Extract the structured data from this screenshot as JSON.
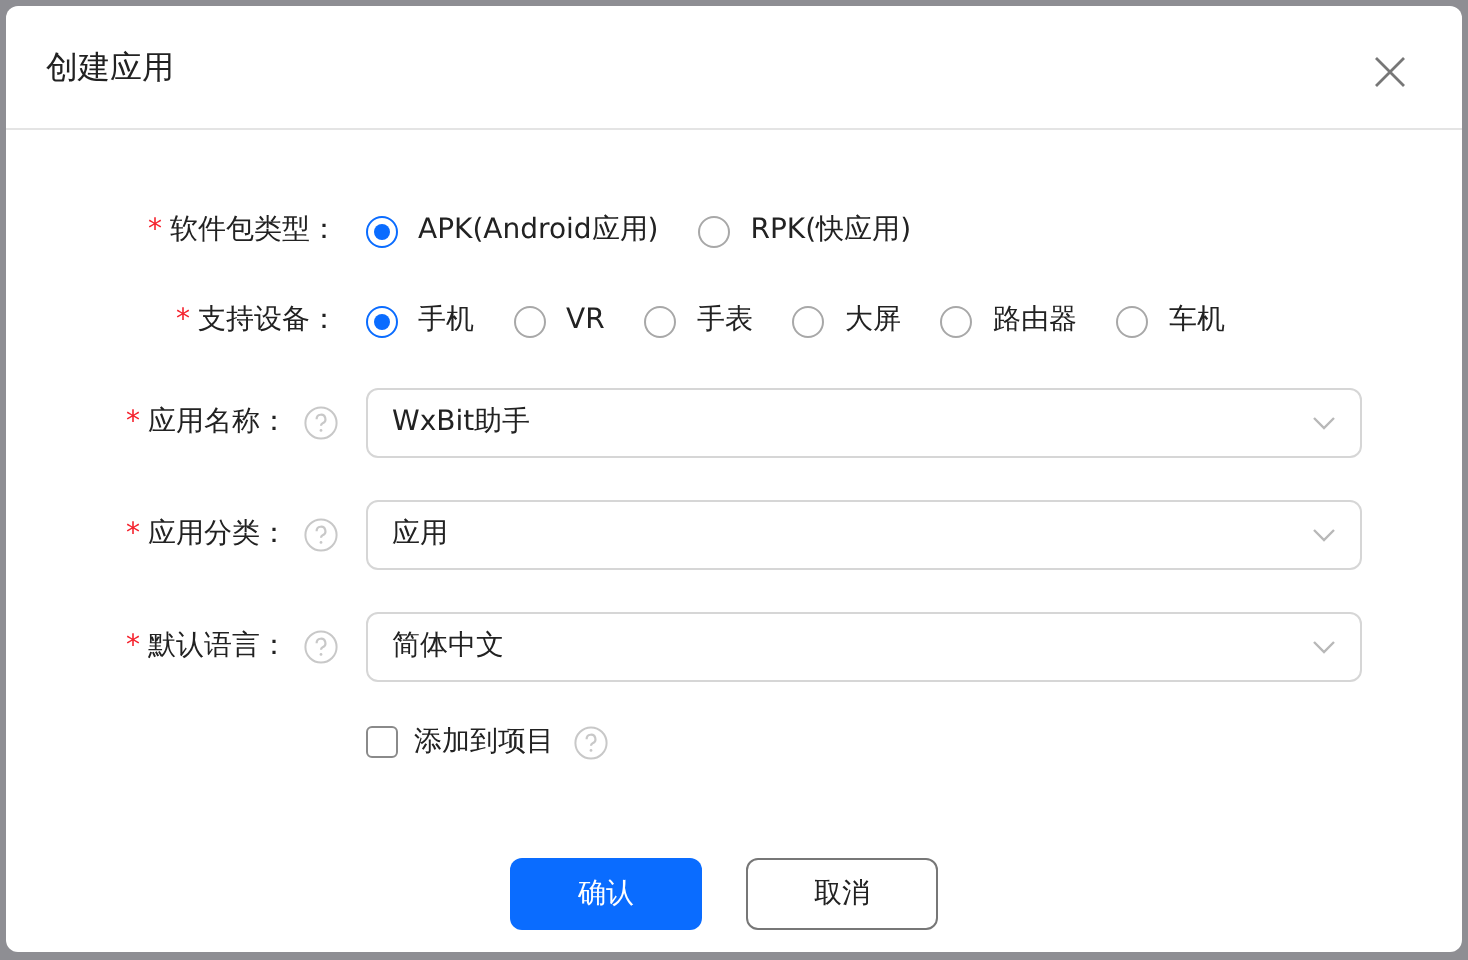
{
  "dialog": {
    "title": "创建应用"
  },
  "fields": [
    {
      "kind": "radio",
      "mark": "*",
      "label": "软件包类型：",
      "help": false,
      "options": [
        {
          "label": "APK(Android应用)",
          "selected": true
        },
        {
          "label": "RPK(快应用)",
          "selected": false
        }
      ]
    },
    {
      "kind": "radio",
      "mark": "*",
      "label": "支持设备：",
      "help": false,
      "options": [
        {
          "label": "手机",
          "selected": true
        },
        {
          "label": "VR",
          "selected": false
        },
        {
          "label": "手表",
          "selected": false
        },
        {
          "label": "大屏",
          "selected": false
        },
        {
          "label": "路由器",
          "selected": false
        },
        {
          "label": "车机",
          "selected": false
        }
      ]
    },
    {
      "kind": "select",
      "mark": "*",
      "label": "应用名称：",
      "help": true,
      "value": "WxBit助手"
    },
    {
      "kind": "select",
      "mark": "*",
      "label": "应用分类：",
      "help": true,
      "value": "应用"
    },
    {
      "kind": "select",
      "mark": "*",
      "label": "默认语言：",
      "help": true,
      "value": "简体中文"
    },
    {
      "kind": "checkbox",
      "label": "添加到项目",
      "help": true,
      "checked": false
    }
  ],
  "buttons": [
    {
      "label": "确认",
      "primary": true
    },
    {
      "label": "取消",
      "primary": false
    }
  ]
}
